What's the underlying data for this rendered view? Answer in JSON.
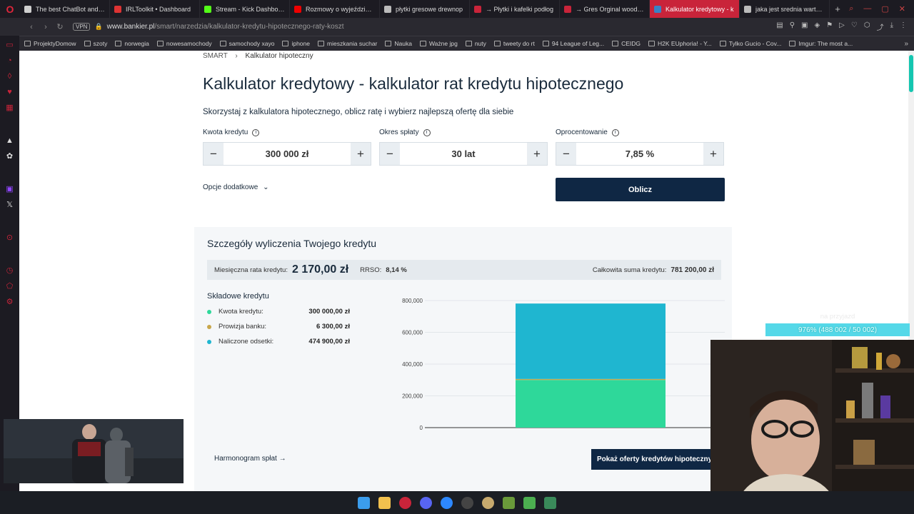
{
  "browser": {
    "tabs": [
      {
        "title": "The best ChatBot and W",
        "color": "#cfcfcf"
      },
      {
        "title": "IRLToolkit • Dashboard",
        "color": "#d33"
      },
      {
        "title": "Stream - Kick Dashboard",
        "color": "#53fc18"
      },
      {
        "title": "Rozmowy o wyjeździe B",
        "color": "#e00"
      },
      {
        "title": "płytki gresowe drewnop",
        "color": "#bbb"
      },
      {
        "title": "→ Płytki i kafelki podłog",
        "color": "#c9243a"
      },
      {
        "title": "→ Gres Orginal wood gr",
        "color": "#c9243a"
      },
      {
        "title": "Kalkulator kredytowy - k",
        "color": "#3a82c4",
        "active": true
      },
      {
        "title": "jaka jest srednia wartosc",
        "color": "#bbb"
      }
    ],
    "address": {
      "vpn": "VPN",
      "host": "www.bankier.pl",
      "path": "/smart/narzedzia/kalkulator-kredytu-hipotecznego-raty-koszt"
    },
    "bookmarks": [
      {
        "label": "ProjektyDomow"
      },
      {
        "label": "szoty"
      },
      {
        "label": "norwegia"
      },
      {
        "label": "nowesamochody"
      },
      {
        "label": "samochody xayo"
      },
      {
        "label": "iphone"
      },
      {
        "label": "mieszkania suchar"
      },
      {
        "label": "Nauka"
      },
      {
        "label": "Ważne jpg"
      },
      {
        "label": "nuty"
      },
      {
        "label": "tweety do rt"
      },
      {
        "label": "94 League of Leg..."
      },
      {
        "label": "CEIDG"
      },
      {
        "label": "H2K EUphoria! - Y..."
      },
      {
        "label": "Tylko Gucio - Cov..."
      },
      {
        "label": "Imgur: The most a..."
      }
    ]
  },
  "page": {
    "breadcrumb": {
      "root": "SMART",
      "current": "Kalkulator hipoteczny"
    },
    "title": "Kalkulator kredytowy - kalkulator rat kredytu hipotecznego",
    "lead": "Skorzystaj z kalkulatora hipotecznego, oblicz ratę i wybierz najlepszą ofertę dla siebie",
    "fields": {
      "amount": {
        "label": "Kwota kredytu",
        "value": "300 000 zł"
      },
      "period": {
        "label": "Okres spłaty",
        "value": "30 lat"
      },
      "rate": {
        "label": "Oprocentowanie",
        "value": "7,85 %"
      }
    },
    "minus": "−",
    "plus": "+",
    "info": "i",
    "more_options": "Opcje dodatkowe",
    "calculate": "Oblicz",
    "details": {
      "title": "Szczegóły wyliczenia Twojego kredytu",
      "monthly_label": "Miesięczna rata kredytu:",
      "monthly_value": "2 170,00 zł",
      "rrso_label": "RRSO:",
      "rrso_value": "8,14 %",
      "total_label": "Całkowita suma kredytu:",
      "total_value": "781 200,00 zł",
      "components_title": "Składowe kredytu",
      "components": [
        {
          "label": "Kwota kredytu:",
          "value": "300 000,00 zł",
          "color": "#2ed89a"
        },
        {
          "label": "Prowizja banku:",
          "value": "6 300,00 zł",
          "color": "#c8a64a"
        },
        {
          "label": "Naliczone odsetki:",
          "value": "474 900,00 zł",
          "color": "#1fb6d0"
        }
      ],
      "schedule": "Harmonogram spłat",
      "offers_button": "Pokaż oferty kredytów hipotecznych"
    }
  },
  "chart_data": {
    "type": "bar",
    "stacked": true,
    "categories": [
      ""
    ],
    "series": [
      {
        "values": [
          300000
        ],
        "color": "#2ed89a"
      },
      {
        "values": [
          6300
        ],
        "color": "#c8a64a"
      },
      {
        "values": [
          474900
        ],
        "color": "#1fb6d0"
      }
    ],
    "ylim": [
      0,
      800000
    ],
    "yticks": [
      "800,000",
      "600,000",
      "400,000",
      "200,000",
      "0"
    ],
    "grid": true
  },
  "overlay": {
    "title": "na przyjazd",
    "progress_text": "976% (488 002 / 50 002)"
  }
}
